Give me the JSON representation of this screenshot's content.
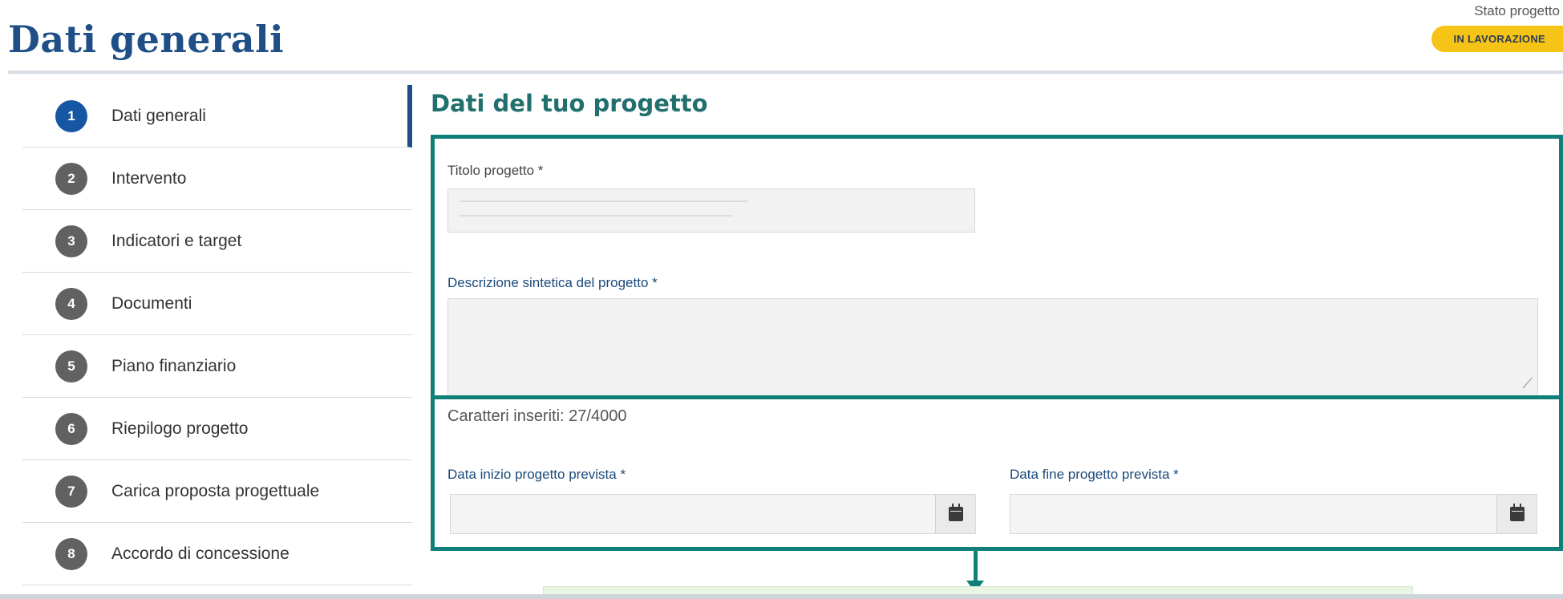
{
  "header": {
    "title": "Dati generali",
    "status_label": "Stato progetto",
    "status_value": "IN LAVORAZIONE",
    "status_color": "#f6c416"
  },
  "sidebar": {
    "items": [
      {
        "num": "1",
        "label": "Dati generali",
        "active": true
      },
      {
        "num": "2",
        "label": "Intervento"
      },
      {
        "num": "3",
        "label": "Indicatori e target"
      },
      {
        "num": "4",
        "label": "Documenti"
      },
      {
        "num": "5",
        "label": "Piano finanziario"
      },
      {
        "num": "6",
        "label": "Riepilogo progetto"
      },
      {
        "num": "7",
        "label": "Carica proposta progettuale"
      },
      {
        "num": "8",
        "label": "Accordo di concessione"
      }
    ]
  },
  "main": {
    "section_title": "Dati del tuo progetto",
    "titolo_label": "Titolo progetto *",
    "descrizione_label": "Descrizione sintetica del progetto *",
    "counter": "Caratteri inseriti: 27/4000",
    "data_inizio_label": "Data inizio progetto prevista *",
    "data_fine_label": "Data fine progetto prevista *"
  },
  "colors": {
    "brand_blue": "#1f4f86",
    "highlight_teal": "#107f7a",
    "active_step": "#1656a2"
  }
}
